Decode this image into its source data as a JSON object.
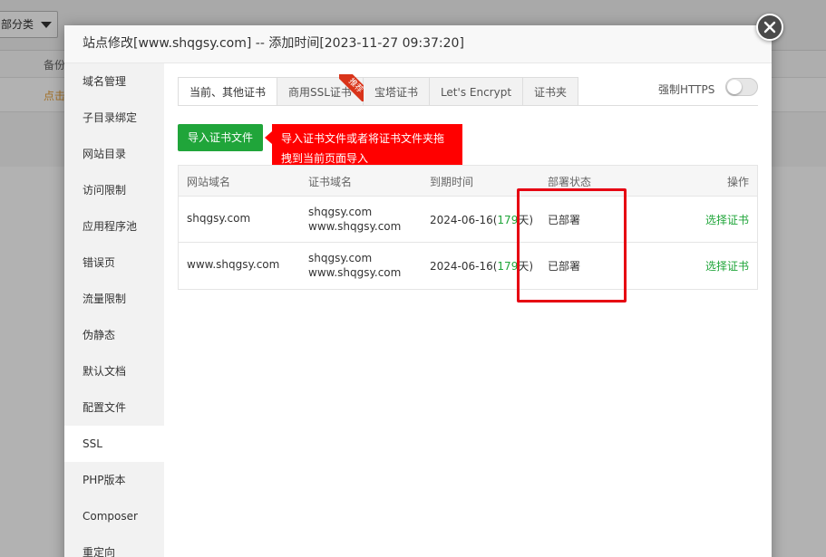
{
  "background": {
    "select_label": "部分类",
    "header_col": "备份",
    "row_link": "点击"
  },
  "modal": {
    "title": "站点修改[www.shqgsy.com] -- 添加时间[2023-11-27 09:37:20]"
  },
  "sidebar": {
    "items": [
      {
        "label": "域名管理"
      },
      {
        "label": "子目录绑定"
      },
      {
        "label": "网站目录"
      },
      {
        "label": "访问限制"
      },
      {
        "label": "应用程序池"
      },
      {
        "label": "错误页"
      },
      {
        "label": "流量限制"
      },
      {
        "label": "伪静态"
      },
      {
        "label": "默认文档"
      },
      {
        "label": "配置文件"
      },
      {
        "label": "SSL"
      },
      {
        "label": "PHP版本"
      },
      {
        "label": "Composer"
      },
      {
        "label": "重定向"
      }
    ],
    "active_index": 10
  },
  "tabs": [
    {
      "label": "当前、其他证书"
    },
    {
      "label": "商用SSL证书"
    },
    {
      "label": "宝塔证书"
    },
    {
      "label": "Let's Encrypt"
    },
    {
      "label": "证书夹"
    }
  ],
  "tab_badge": "推荐",
  "force_https": {
    "label": "强制HTTPS",
    "enabled": false
  },
  "import_button": "导入证书文件",
  "tooltip": {
    "line1": "导入证书文件或者将证书文件夹拖",
    "line2": "拽到当前页面导入"
  },
  "table": {
    "headers": {
      "site": "网站域名",
      "cert": "证书域名",
      "expire": "到期时间",
      "status": "部署状态",
      "action": "操作"
    },
    "rows": [
      {
        "site": "shqgsy.com",
        "cert1": "shqgsy.com",
        "cert2": "www.shqgsy.com",
        "date": "2024-06-16(",
        "days": "179",
        "suffix": "天)",
        "status": "已部署",
        "action": "选择证书"
      },
      {
        "site": "www.shqgsy.com",
        "cert1": "shqgsy.com",
        "cert2": "www.shqgsy.com",
        "date": "2024-06-16(",
        "days": "179",
        "suffix": "天)",
        "status": "已部署",
        "action": "选择证书"
      }
    ]
  },
  "colors": {
    "primary_green": "#20a53a",
    "tip_red": "#ff0000",
    "highlight_red": "#e60012"
  }
}
